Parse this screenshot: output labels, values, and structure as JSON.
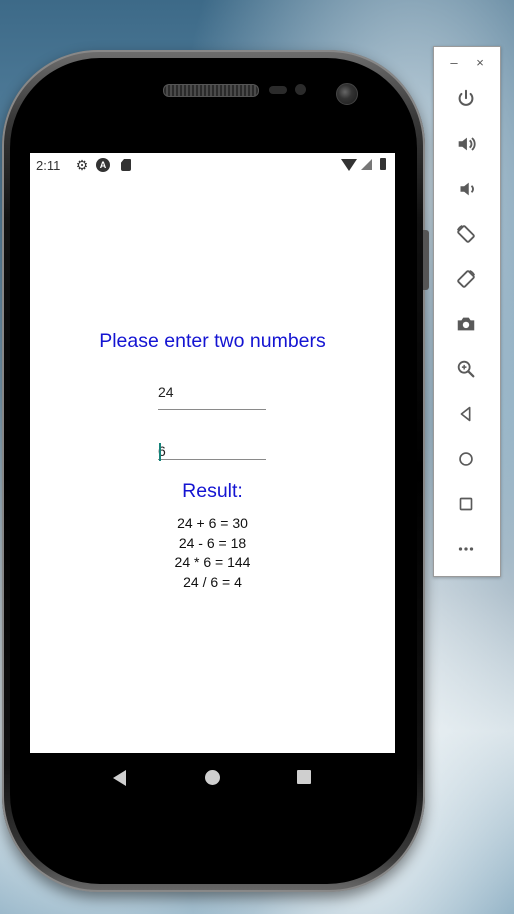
{
  "status_bar": {
    "time": "2:11",
    "icons": [
      "gear-icon",
      "a-icon",
      "sd-card-icon",
      "wifi-icon",
      "signal-icon",
      "battery-icon"
    ]
  },
  "app": {
    "heading": "Please enter two numbers",
    "first_value": "24",
    "second_value": "6",
    "result_label": "Result:",
    "results": [
      "24 + 6 = 30",
      "24 - 6 = 18",
      "24 * 6 = 144",
      "24 / 6 = 4"
    ]
  },
  "colors": {
    "accent_text": "#1414d2",
    "cursor": "#16837a"
  },
  "nav_bar": {
    "buttons": [
      "back-icon",
      "home-icon",
      "recents-icon"
    ]
  },
  "emulator_toolbar": {
    "window_controls": {
      "minimize": "–",
      "close": "×"
    },
    "items": [
      "power-icon",
      "volume-up-icon",
      "volume-down-icon",
      "rotate-left-icon",
      "rotate-right-icon",
      "camera-icon",
      "zoom-icon",
      "back-icon",
      "home-icon",
      "overview-icon",
      "more-icon"
    ]
  }
}
